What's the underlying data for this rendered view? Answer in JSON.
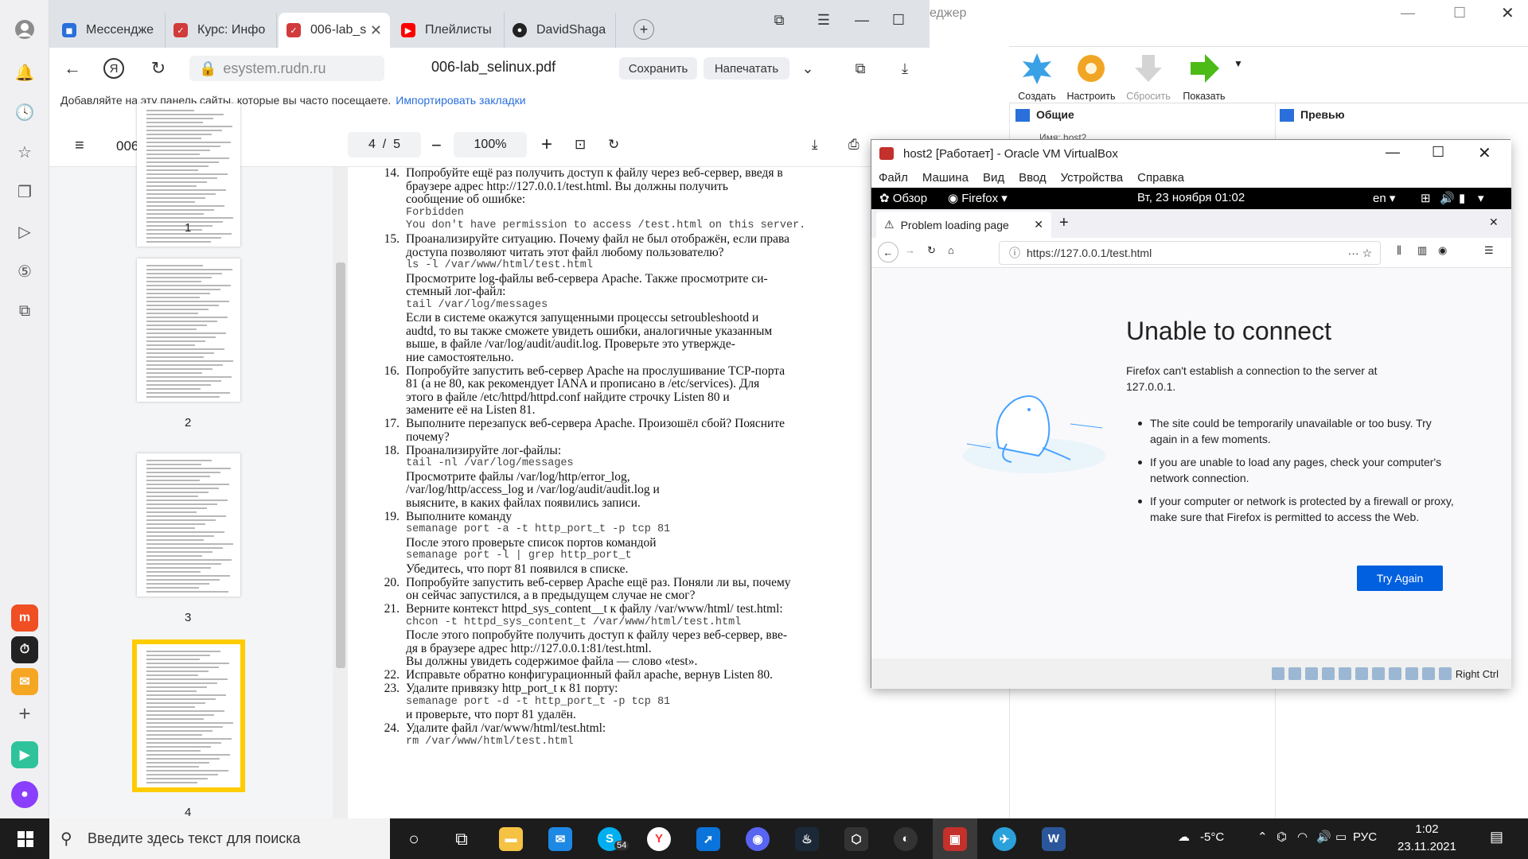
{
  "browser": {
    "tabs": [
      {
        "label": "Мессендже",
        "color": "#2a6fdb"
      },
      {
        "label": "Курс: Инфо",
        "color": "#d23b3b"
      },
      {
        "label": "006-lab_s",
        "color": "#d23b3b"
      },
      {
        "label": "Плейлисты",
        "color": "#ff0000"
      },
      {
        "label": "DavidShaga",
        "color": "#222222"
      }
    ],
    "url": "esystem.rudn.ru",
    "page_title": "006-lab_selinux.pdf",
    "save_label": "Сохранить",
    "print_label": "Напечатать",
    "bookmarks_hint": "Добавляйте на эту панель сайты, которые вы часто посещаете.",
    "import_label": "Импортировать закладки"
  },
  "pdf": {
    "filename": "006-lab_selinux.pdf",
    "page_current": "4",
    "page_sep": "/",
    "page_total": "5",
    "zoom": "100%",
    "thumb_labels": [
      "1",
      "2",
      "3",
      "4"
    ],
    "items": [
      {
        "n": "14.",
        "lines": [
          "Попробуйте ещё раз получить доступ к файлу через веб-сервер, введя в",
          "браузере адрес http://127.0.0.1/test.html. Вы должны получить",
          "сообщение об ошибке:",
          "Forbidden",
          "You don't have permission to access /test.html on this server."
        ]
      },
      {
        "n": "15.",
        "lines": [
          "Проанализируйте ситуацию. Почему файл не был отображён, если права",
          "доступа позволяют читать этот файл любому пользователю?",
          "ls -l /var/www/html/test.html",
          "Просмотрите log-файлы веб-сервера Apache. Также просмотрите си-",
          "стемный лог-файл:",
          "tail /var/log/messages",
          "Если в системе окажутся запущенными процессы setroubleshootd и",
          "audtd, то вы также сможете увидеть ошибки, аналогичные указанным",
          "выше, в файле /var/log/audit/audit.log. Проверьте это утвержде-",
          "ние самостоятельно."
        ]
      },
      {
        "n": "16.",
        "lines": [
          "Попробуйте запустить веб-сервер Apache на прослушивание TCP-порта",
          "81 (а не 80, как рекомендует IANA и прописано в /etc/services). Для",
          "этого в файле /etc/httpd/httpd.conf найдите строчку Listen 80 и",
          "замените её на Listen 81."
        ]
      },
      {
        "n": "17.",
        "lines": [
          "Выполните перезапуск веб-сервера Apache. Произошёл сбой? Поясните",
          "почему?"
        ]
      },
      {
        "n": "18.",
        "lines": [
          "Проанализируйте лог-файлы:",
          "tail -nl /var/log/messages",
          "Просмотрите        файлы        /var/log/http/error_log,",
          "/var/log/http/access_log  и  /var/log/audit/audit.log  и",
          "выясните, в каких файлах появились записи."
        ]
      },
      {
        "n": "19.",
        "lines": [
          "Выполните команду",
          "semanage port -a -t http_port_t -p tcp 81",
          "После этого проверьте список портов командой",
          "semanage port -l | grep http_port_t",
          "Убедитесь, что порт 81 появился в списке."
        ]
      },
      {
        "n": "20.",
        "lines": [
          "Попробуйте запустить веб-сервер Apache ещё раз. Поняли ли вы, почему",
          "он сейчас запустился, а в предыдущем случае не смог?"
        ]
      },
      {
        "n": "21.",
        "lines": [
          "Верните контекст httpd_sys_content__t к файлу /var/www/html/ test.html:",
          "chcon -t httpd_sys_content_t /var/www/html/test.html",
          "После этого попробуйте получить доступ к файлу через веб-сервер, вве-",
          "дя в браузере адрес http://127.0.0.1:81/test.html.",
          "Вы должны увидеть содержимое файла — слово «test»."
        ]
      },
      {
        "n": "22.",
        "lines": [
          "Исправьте обратно конфигурационный файл apache, вернув Listen 80."
        ]
      },
      {
        "n": "23.",
        "lines": [
          "Удалите привязку http_port_t к 81 порту:",
          "semanage port -d -t http_port_t -p tcp 81",
          "и проверьте, что порт 81 удалён."
        ]
      },
      {
        "n": "24.",
        "lines": [
          "Удалите файл /var/www/html/test.html:",
          "rm /var/www/html/test.html"
        ]
      }
    ]
  },
  "vbox_manager": {
    "title_fragment": "еджер",
    "tools": [
      "Создать",
      "Настроить",
      "Сбросить",
      "Показать"
    ],
    "general_label": "Общие",
    "preview_label": "Превью",
    "name_fragment": "Имя:    host2"
  },
  "vm": {
    "title": "host2 [Работает] - Oracle VM VirtualBox",
    "menu": [
      "Файл",
      "Машина",
      "Вид",
      "Ввод",
      "Устройства",
      "Справка"
    ],
    "gnome": {
      "activities": "Обзор",
      "app": "Firefox",
      "clock": "Вт, 23 ноября  01:02",
      "lang": "en"
    },
    "firefox": {
      "tab_title": "Problem loading page",
      "url": "https://127.0.0.1/test.html",
      "heading": "Unable to connect",
      "message": "Firefox can't establish a connection to the server at 127.0.0.1.",
      "bullets": [
        "The site could be temporarily unavailable or too busy. Try again in a few moments.",
        "If you are unable to load any pages, check your computer's network connection.",
        "If your computer or network is protected by a firewall or proxy, make sure that Firefox is permitted to access the Web."
      ],
      "try_again": "Try Again"
    },
    "host_key": "Right Ctrl"
  },
  "taskbar": {
    "search_placeholder": "Введите здесь текст для поиска",
    "skype_badge": "54",
    "weather": "-5°C",
    "lang": "РУС",
    "time": "1:02",
    "date": "23.11.2021"
  }
}
